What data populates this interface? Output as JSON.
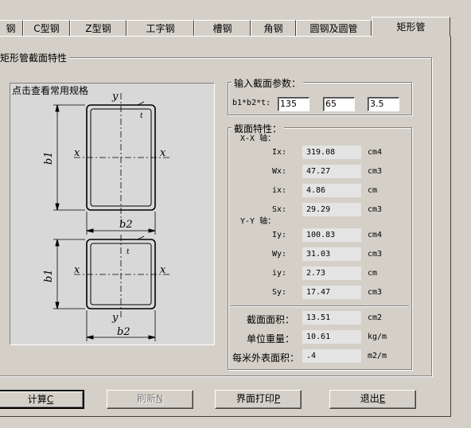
{
  "tabs": [
    {
      "label": "钢"
    },
    {
      "label": "C型钢"
    },
    {
      "label": "Z型钢"
    },
    {
      "label": "工字钢"
    },
    {
      "label": "槽钢"
    },
    {
      "label": "角钢"
    },
    {
      "label": "圆钢及圆管"
    },
    {
      "label": "矩形管"
    }
  ],
  "section_group": {
    "title": "矩形管截面特性"
  },
  "image_panel": {
    "caption": "点击查看常用规格",
    "labels": {
      "y": "y",
      "x": "x",
      "b1": "b1",
      "b2": "b2",
      "t": "t"
    }
  },
  "input_group": {
    "title": "输入截面参数：",
    "param_label": "b1*b2*t:",
    "b1": "135",
    "b2": "65",
    "t": "3.5"
  },
  "props_group": {
    "title": "截面特性：",
    "xx_title": "X-X 轴：",
    "yy_title": "Y-Y 轴：",
    "xx": [
      {
        "label": "Ix:",
        "value": "319.08",
        "unit": "cm4"
      },
      {
        "label": "Wx:",
        "value": "47.27",
        "unit": "cm3"
      },
      {
        "label": "ix:",
        "value": "4.86",
        "unit": "cm"
      },
      {
        "label": "Sx:",
        "value": "29.29",
        "unit": "cm3"
      }
    ],
    "yy": [
      {
        "label": "Iy:",
        "value": "100.83",
        "unit": "cm4"
      },
      {
        "label": "Wy:",
        "value": "31.03",
        "unit": "cm3"
      },
      {
        "label": "iy:",
        "value": "2.73",
        "unit": "cm"
      },
      {
        "label": "Sy:",
        "value": "17.47",
        "unit": "cm3"
      }
    ],
    "general": [
      {
        "label": "截面面积：",
        "value": "13.51",
        "unit": "cm2"
      },
      {
        "label": "单位重量：",
        "value": "10.61",
        "unit": "kg/m"
      },
      {
        "label": "每米外表面积：",
        "value": ".4",
        "unit": "m2/m"
      }
    ]
  },
  "buttons": {
    "calc": {
      "label": "计算",
      "key": "C"
    },
    "refresh": {
      "label": "刷新",
      "key": "N"
    },
    "print": {
      "label": "界面打印",
      "key": "P"
    },
    "exit": {
      "label": "退出",
      "key": "E"
    }
  }
}
